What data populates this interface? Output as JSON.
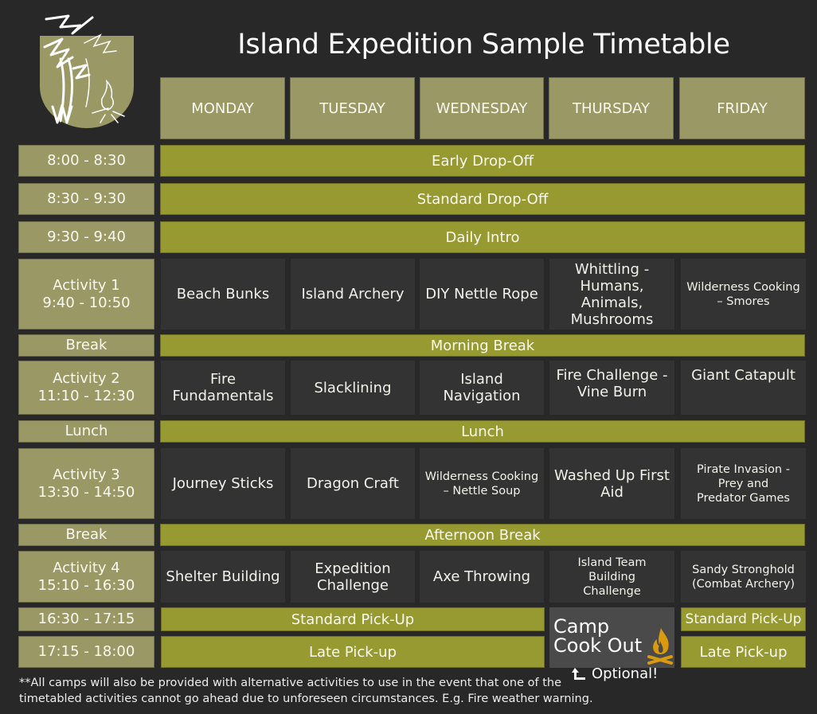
{
  "title": "Island Expedition Sample Timetable",
  "logo": {
    "icon": "palm-tree-campfire-shield-icon"
  },
  "days": [
    "MONDAY",
    "TUESDAY",
    "WEDNESDAY",
    "THURSDAY",
    "FRIDAY"
  ],
  "rows": [
    {
      "time": "8:00 - 8:30",
      "all_days": "Early Drop-Off"
    },
    {
      "time": "8:30 - 9:30",
      "all_days": "Standard Drop-Off"
    },
    {
      "time": "9:30 - 9:40",
      "all_days": "Daily Intro"
    },
    {
      "time_label": "Activity 1",
      "time": "9:40 - 10:50",
      "activities": [
        "Beach Bunks",
        "Island Archery",
        "DIY Nettle Rope",
        "Whittling - Humans, Animals, Mushrooms",
        "Wilderness Cooking – Smores"
      ]
    },
    {
      "time": "Break",
      "all_days": "Morning Break"
    },
    {
      "time_label": "Activity 2",
      "time": "11:10 - 12:30",
      "activities": [
        "Fire Fundamentals",
        "Slacklining",
        "Island Navigation",
        "Fire Challenge - Vine Burn",
        "Giant Catapult"
      ]
    },
    {
      "time": "Lunch",
      "all_days": "Lunch"
    },
    {
      "time_label": "Activity 3",
      "time": "13:30 - 14:50",
      "activities": [
        "Journey Sticks",
        "Dragon Craft",
        "Wilderness Cooking – Nettle Soup",
        "Washed Up First Aid",
        "Pirate Invasion - Prey and Predator Games"
      ]
    },
    {
      "time": "Break",
      "all_days": "Afternoon Break"
    },
    {
      "time_label": "Activity 4",
      "time": "15:10 - 16:30",
      "activities": [
        "Shelter Building",
        "Expedition Challenge",
        "Axe Throwing",
        "Island Team Building Challenge",
        "Sandy Stronghold (Combat Archery)"
      ]
    },
    {
      "time": "16:30 - 17:15",
      "mon_wed": "Standard Pick-Up",
      "friday": "Standard Pick-Up"
    },
    {
      "time": "17:15 - 18:00",
      "mon_wed": "Late Pick-up",
      "friday": "Late Pick-up"
    }
  ],
  "thursday_special": {
    "line1": "Camp",
    "line2": "Cook Out",
    "icon": "campfire-icon",
    "note": "Optional!",
    "note_icon": "arrow-up-left-icon"
  },
  "footnote": {
    "line1": "**All camps will also be provided with alternative activities to use in the event that one of the",
    "line2": "timetabled activities cannot go ahead due to unforeseen circumstances. E.g. Fire weather warning."
  },
  "colors": {
    "background": "#282828",
    "header_cell": "#9a9864",
    "bar": "#979931",
    "activity_cell": "#333333",
    "cookout_cell": "#4a4a4a",
    "campfire": "#d99a10"
  }
}
